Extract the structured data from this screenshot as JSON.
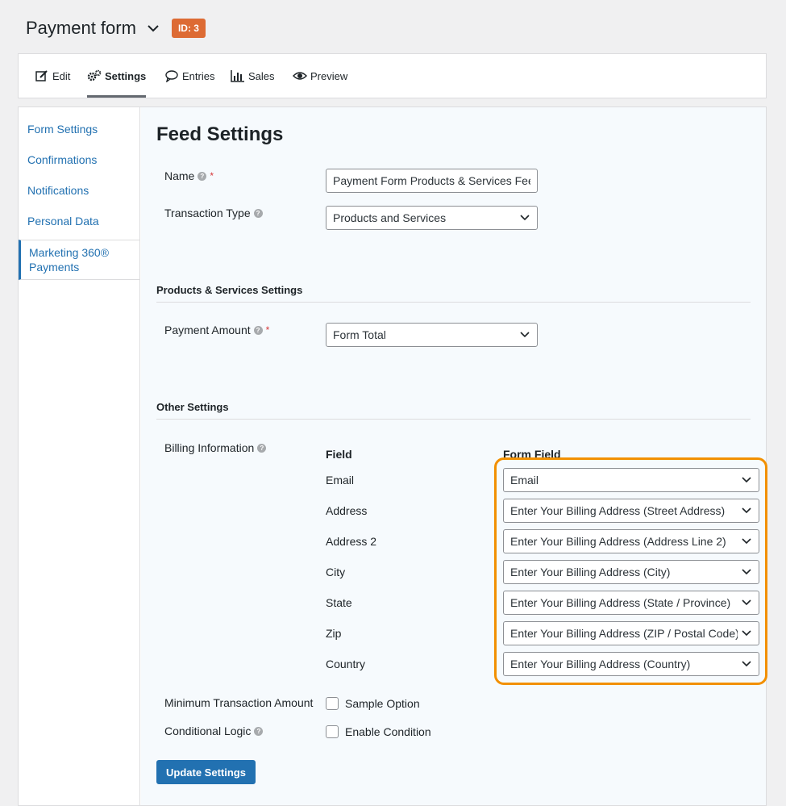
{
  "header": {
    "title": "Payment form",
    "badge": "ID: 3"
  },
  "tabs": [
    {
      "label": "Edit",
      "icon": "edit-icon"
    },
    {
      "label": "Settings",
      "icon": "gear-icon"
    },
    {
      "label": "Entries",
      "icon": "comment-icon"
    },
    {
      "label": "Sales",
      "icon": "bar-chart-icon"
    },
    {
      "label": "Preview",
      "icon": "eye-icon"
    }
  ],
  "sidebar": {
    "items": [
      {
        "label": "Form Settings"
      },
      {
        "label": "Confirmations"
      },
      {
        "label": "Notifications"
      },
      {
        "label": "Personal Data"
      },
      {
        "label": "Marketing 360® Payments"
      }
    ]
  },
  "main": {
    "title": "Feed Settings",
    "name": {
      "label": "Name",
      "value": "Payment Form Products & Services Feed"
    },
    "transaction_type": {
      "label": "Transaction Type",
      "value": "Products and Services"
    },
    "products_section": "Products & Services Settings",
    "payment_amount": {
      "label": "Payment Amount",
      "value": "Form Total"
    },
    "other_section": "Other Settings",
    "billing": {
      "label": "Billing Information",
      "col_field": "Field",
      "col_form_field": "Form Field",
      "rows": [
        {
          "field": "Email",
          "value": "Email"
        },
        {
          "field": "Address",
          "value": "Enter Your Billing Address (Street Address)"
        },
        {
          "field": "Address 2",
          "value": "Enter Your Billing Address (Address Line 2)"
        },
        {
          "field": "City",
          "value": "Enter Your Billing Address (City)"
        },
        {
          "field": "State",
          "value": "Enter Your Billing Address (State / Province)"
        },
        {
          "field": "Zip",
          "value": "Enter Your Billing Address (ZIP / Postal Code)"
        },
        {
          "field": "Country",
          "value": "Enter Your Billing Address (Country)"
        }
      ]
    },
    "min_amount": {
      "label": "Minimum Transaction Amount",
      "option": "Sample Option"
    },
    "conditional": {
      "label": "Conditional Logic",
      "option": "Enable Condition"
    },
    "update_button": "Update Settings"
  },
  "colors": {
    "accent": "#2271b1",
    "badge": "#dd6b34",
    "highlight": "#f29000"
  }
}
